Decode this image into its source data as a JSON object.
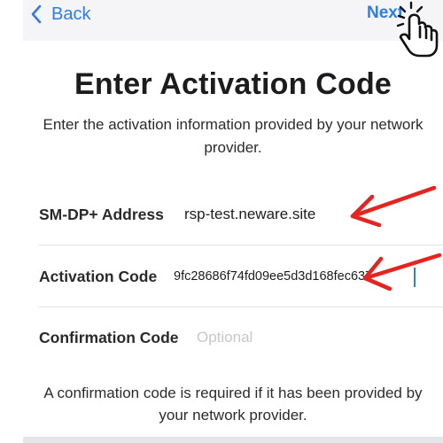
{
  "navbar": {
    "back_label": "Back",
    "next_label": "Next",
    "back_icon": "chevron-left-icon",
    "next_overlay_icon": "pointing-hand-icon"
  },
  "header": {
    "title": "Enter Activation Code",
    "subtitle": "Enter the activation information provided by your network provider."
  },
  "form": {
    "sm_dp": {
      "label": "SM-DP+ Address",
      "value": "rsp-test.neware.site"
    },
    "activation_code": {
      "label": "Activation Code",
      "value": "9fc28686f74fd09ee5d3d168fec637"
    },
    "confirmation_code": {
      "label": "Confirmation Code",
      "placeholder": "Optional",
      "value": ""
    }
  },
  "footer": {
    "note": "A confirmation code is required if it has been provided by your network provider."
  },
  "colors": {
    "accent": "#2e7bf0",
    "annotation": "#e8231f",
    "navbar_bg": "#f5f5f7",
    "placeholder": "#c7c7cc"
  },
  "annotations": {
    "arrow_icon": "red-arrow-icon"
  }
}
